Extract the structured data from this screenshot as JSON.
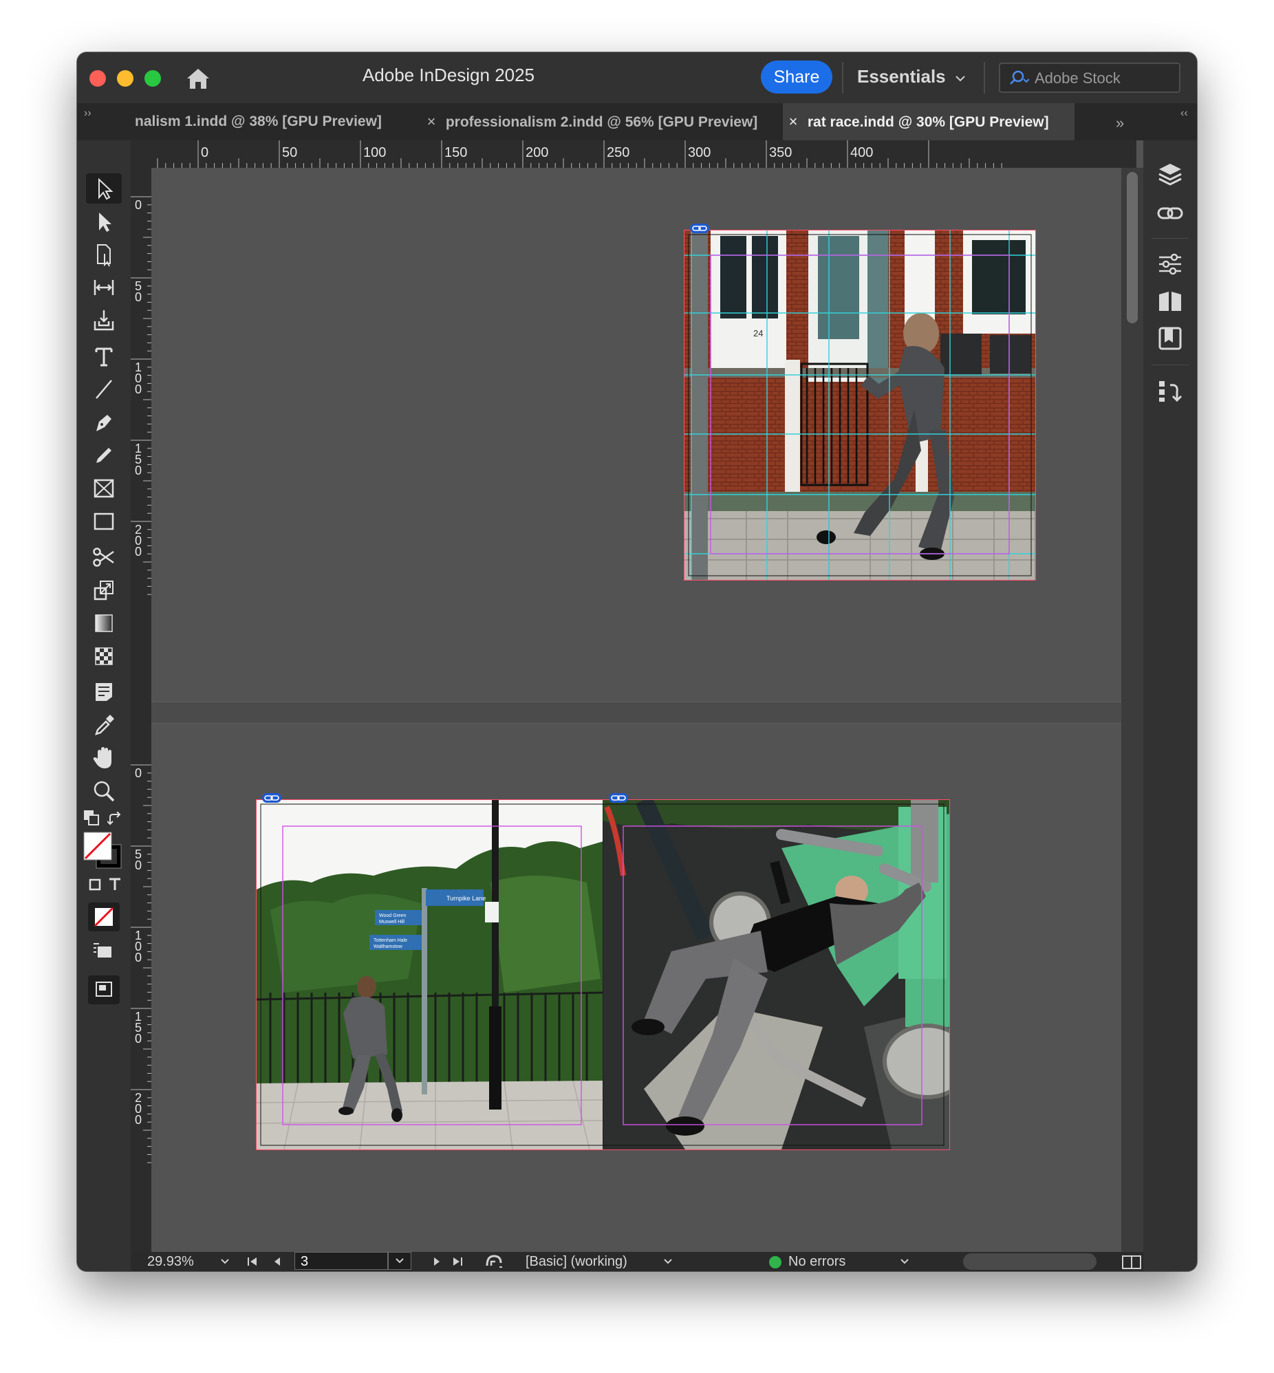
{
  "window": {
    "app_title": "Adobe InDesign 2025",
    "share_label": "Share",
    "workspace_label": "Essentials",
    "stock_placeholder": "Adobe Stock"
  },
  "tabs": [
    {
      "label": "nalism 1.indd @ 38% [GPU Preview]",
      "active": false
    },
    {
      "label": "professionalism 2.indd @ 56% [GPU Preview]",
      "active": false
    },
    {
      "label": "rat race.indd @ 30% [GPU Preview]",
      "active": true
    }
  ],
  "tab_close_glyph": "×",
  "ruler": {
    "horizontal": [
      "0",
      "50",
      "100",
      "150",
      "200",
      "250",
      "300",
      "350",
      "400"
    ],
    "vertical_spread1": [
      "0",
      "50",
      "100",
      "150",
      "200"
    ],
    "vertical_spread2": [
      "0",
      "50",
      "100",
      "150",
      "200"
    ]
  },
  "tools": [
    "selection-icon",
    "direct-selection-icon",
    "page-tool-icon",
    "gap-tool-icon",
    "content-collector-icon",
    "type-tool-icon",
    "line-tool-icon",
    "pen-tool-icon",
    "pencil-tool-icon",
    "rectangle-frame-icon",
    "rectangle-tool-icon",
    "scissors-icon",
    "free-transform-icon",
    "gradient-swatch-icon",
    "gradient-feather-icon",
    "note-tool-icon",
    "eyedropper-icon",
    "hand-tool-icon",
    "zoom-tool-icon"
  ],
  "right_panels": [
    "layers-icon",
    "links-icon",
    "properties-icon",
    "pages-icon",
    "cc-libraries-icon",
    "align-icon"
  ],
  "colors": {
    "accent": "#1b6ee8",
    "frame_edge": "#ff4d6a",
    "margin_guide": "#d050e8",
    "column_guide": "#33d1d9",
    "status_ok": "#2fb34a"
  },
  "status": {
    "zoom": "29.93%",
    "page": "3",
    "preflight_profile": "[Basic] (working)",
    "errors": "No errors"
  },
  "images": [
    {
      "name": "brick-house-runner",
      "description": "man in suit running past brick terrace"
    },
    {
      "name": "street-sign-runner",
      "description": "man running past cycle signpost"
    },
    {
      "name": "gym-bench-press",
      "description": "man in suit on outdoor gym machine"
    }
  ],
  "signs": {
    "sign_a": "Turnpike Lane",
    "sign_b1": "Wood Green",
    "sign_b2": "Muswell Hill",
    "sign_c1": "Tottenham Hale",
    "sign_c2": "Walthamstow",
    "door_number": "24"
  }
}
